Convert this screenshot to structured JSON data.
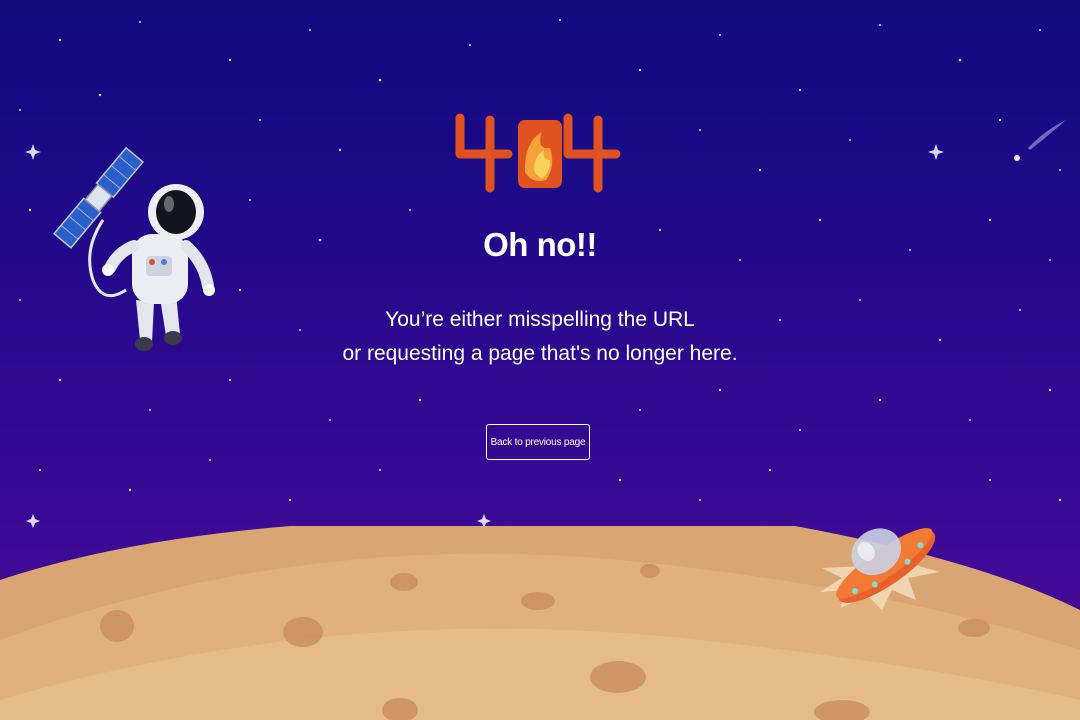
{
  "error": {
    "code_logo": "404",
    "title": "Oh no!!",
    "message_line1": "You’re either misspelling the URL",
    "message_line2": "or requesting a page that's no longer here."
  },
  "actions": {
    "back_label": "Back to previous page"
  },
  "icons": {
    "astronaut": "astronaut-with-satellite-icon",
    "ufo": "crashed-ufo-icon",
    "shooting_star": "shooting-star-icon"
  },
  "colors": {
    "sky_top": "#110b80",
    "sky_bottom": "#4a0b98",
    "logo_orange": "#e0521f",
    "ground": "#d9a572"
  }
}
